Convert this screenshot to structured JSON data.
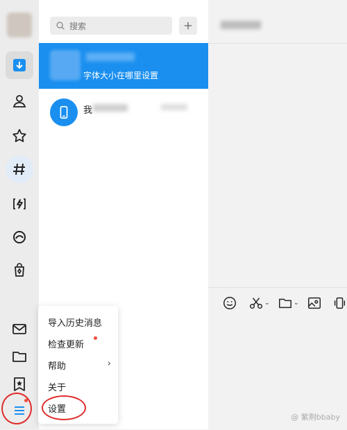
{
  "search": {
    "placeholder": "搜索"
  },
  "conversations": [
    {
      "preview": "字体大小在哪里设置"
    },
    {
      "title": "我"
    }
  ],
  "menu": {
    "items": [
      {
        "label": "导入历史消息"
      },
      {
        "label": "检查更新"
      },
      {
        "label": "帮助"
      },
      {
        "label": "关于"
      },
      {
        "label": "设置"
      }
    ]
  },
  "watermark": "@ 紫荆bbaby",
  "colors": {
    "accent": "#1a8ff0",
    "rail_bg": "#ececec",
    "alert_red": "#f04a3c",
    "annotation_red": "#e02b2b"
  },
  "rail_icons": [
    "avatar",
    "download-icon",
    "contacts-icon",
    "favorites-icon",
    "channels-icon",
    "mini-apps-icon",
    "moments-icon",
    "shopping-icon",
    "mail-icon",
    "folder-icon",
    "bookmark-icon",
    "menu-icon"
  ],
  "chat_toolbar_icons": [
    "emoji-icon",
    "scissors-icon",
    "folder-icon",
    "screenshot-icon",
    "phone-icon"
  ]
}
